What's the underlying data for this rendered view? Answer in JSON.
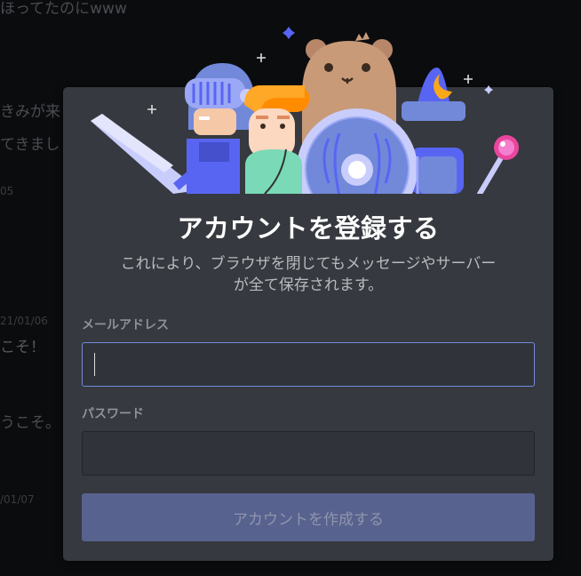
{
  "background_chat": {
    "line1": "ほってたのにwww",
    "line2": "きみが来",
    "line3": "てきまし",
    "time1": "05",
    "time2": "21/01/06",
    "line4": "こそ！",
    "line5": "うこそ。",
    "time3": "/01/07"
  },
  "modal": {
    "title": "アカウントを登録する",
    "subtitle_line1": "これにより、ブラウザを閉じてもメッセージやサーバー",
    "subtitle_line2": "が全て保存されます。",
    "email_label": "メールアドレス",
    "email_value": "",
    "password_label": "パスワード",
    "password_value": "",
    "submit_label": "アカウントを作成する"
  },
  "colors": {
    "modal_bg": "#36393f",
    "accent": "#7289da",
    "button_disabled": "#58628f"
  }
}
